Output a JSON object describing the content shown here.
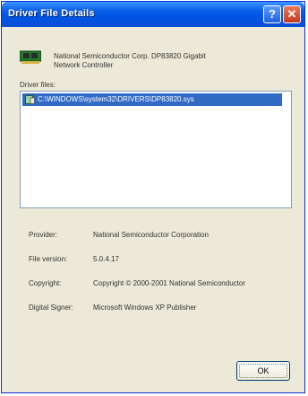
{
  "window": {
    "title": "Driver File Details",
    "help_label": "?",
    "close_label": "✕"
  },
  "device": {
    "name_line1": "National Semiconductor Corp. DP83820 Gigabit",
    "name_line2": "Network Controller",
    "icon": "network-card-icon"
  },
  "driver_files": {
    "label": "Driver files:",
    "items": [
      {
        "path": "C:\\WINDOWS\\system32\\DRIVERS\\DP83820.sys",
        "icon": "file-icon"
      }
    ]
  },
  "properties": [
    {
      "label": "Provider:",
      "value": "National Semiconductor Corporation"
    },
    {
      "label": "File version:",
      "value": "5.0.4.17"
    },
    {
      "label": "Copyright:",
      "value": "Copyright © 2000-2001 National Semiconductor"
    },
    {
      "label": "Digital Signer:",
      "value": "Microsoft Windows XP Publisher"
    }
  ],
  "buttons": {
    "ok_label": "OK"
  },
  "colors": {
    "titlebar": "#0054e3",
    "selection": "#316ac5",
    "dialog_bg": "#ece9d8"
  }
}
